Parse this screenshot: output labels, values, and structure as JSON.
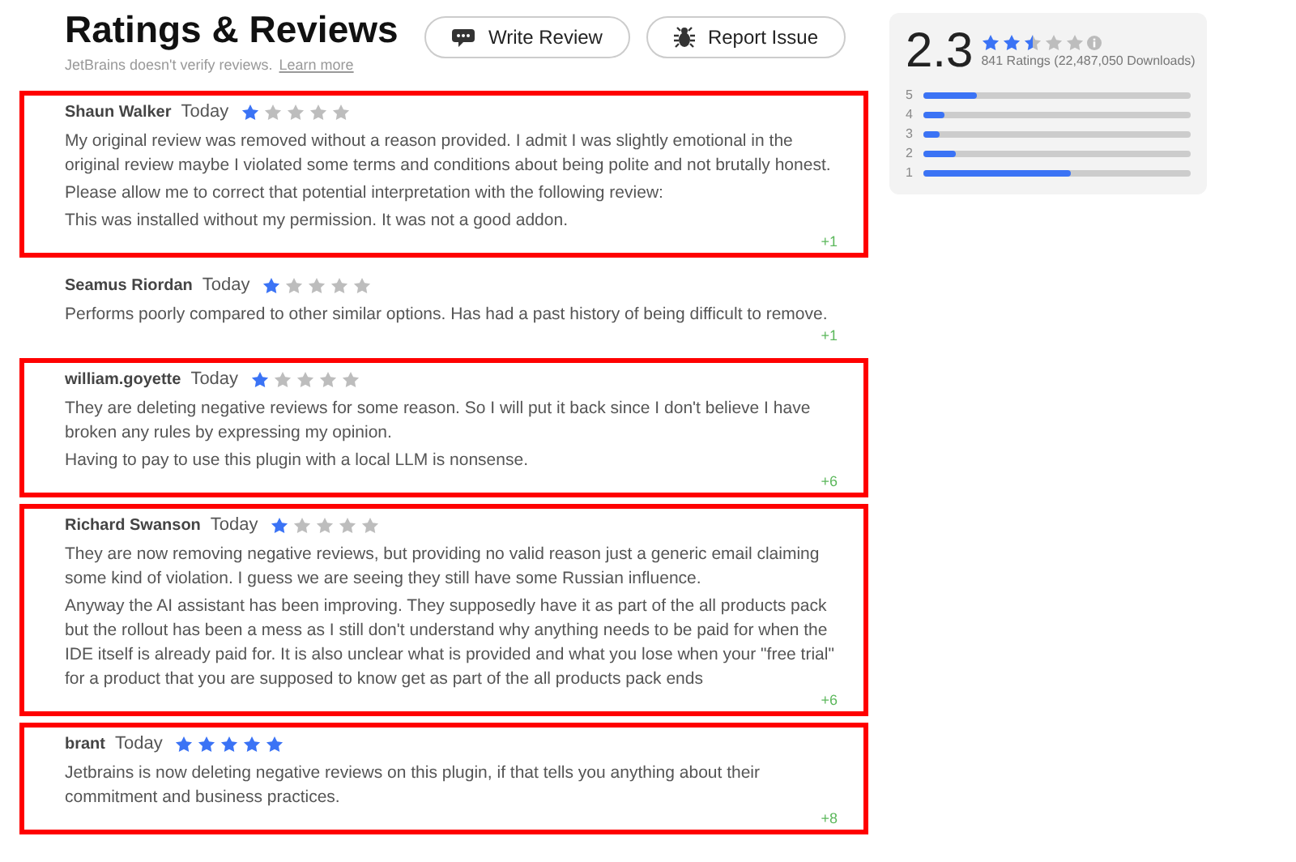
{
  "header": {
    "title": "Ratings & Reviews",
    "subtitle": "JetBrains doesn't verify reviews.",
    "link": "Learn more",
    "buttons": [
      {
        "kind": "comment",
        "label": "Write Review"
      },
      {
        "kind": "bug",
        "label": "Report Issue"
      }
    ]
  },
  "summary": {
    "score": "2.3",
    "stars": 2.5,
    "ratings": "841 Ratings",
    "downloads": "(22,487,050 Downloads)",
    "bars": [
      {
        "label": "5",
        "level": 0.2
      },
      {
        "label": "4",
        "level": 0.08
      },
      {
        "label": "3",
        "level": 0.06
      },
      {
        "label": "2",
        "level": 0.12
      },
      {
        "label": "1",
        "level": 0.55
      }
    ]
  },
  "reviews": [
    {
      "author": "Shaun Walker",
      "date": "Today",
      "stars": 1,
      "highlighted": true,
      "paragraphs": [
        "My original review was removed without a reason provided. I admit I was slightly emotional in the original review maybe I violated some terms and conditions about being polite and not brutally honest.",
        "Please allow me to correct that potential interpretation with the following review:",
        "This was installed without my permission. It was not a good addon."
      ],
      "votes": "+1"
    },
    {
      "author": "Seamus Riordan",
      "date": "Today",
      "stars": 1,
      "highlighted": false,
      "paragraphs": [
        "Performs poorly compared to other similar options. Has had a past history of being difficult to remove."
      ],
      "votes": "+1"
    },
    {
      "author": "william.goyette",
      "date": "Today",
      "stars": 1,
      "highlighted": true,
      "paragraphs": [
        "They are deleting negative reviews for some reason. So I will put it back since I don't believe I have broken any rules by expressing my opinion.",
        "Having to pay to use this plugin with a local LLM is nonsense."
      ],
      "votes": "+6"
    },
    {
      "author": "Richard Swanson",
      "date": "Today",
      "stars": 1,
      "highlighted": true,
      "paragraphs": [
        "They are now removing negative reviews, but providing no valid reason just a generic email claiming some kind of violation. I guess we are seeing they still have some Russian influence.",
        "Anyway the AI assistant has been improving. They supposedly have it as part of the all products pack but the rollout has been a mess as I still don't understand why anything needs to be paid for when the IDE itself is already paid for. It is also unclear what is provided and what you lose when your \"free trial\" for a product that you are supposed to know get as part of the all products pack ends"
      ],
      "votes": "+6"
    },
    {
      "author": "brant",
      "date": "Today",
      "stars": 5,
      "highlighted": true,
      "paragraphs": [
        "Jetbrains is now deleting negative reviews on this plugin, if that tells you anything about their commitment and business practices."
      ],
      "votes": "+8"
    }
  ]
}
